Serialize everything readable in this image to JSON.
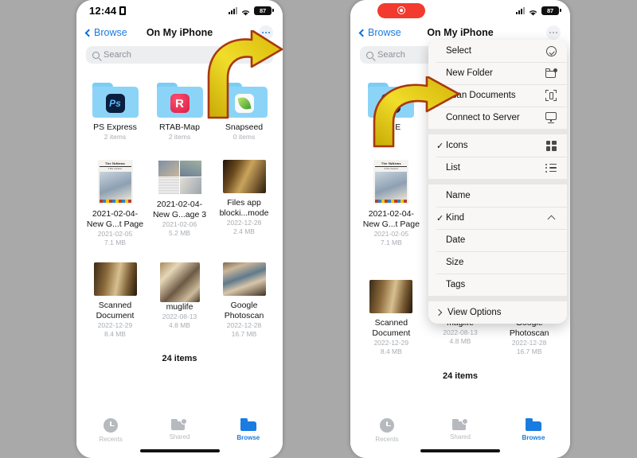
{
  "background_color": "#a9a9a9",
  "accent_color": "#1a7be0",
  "phones": [
    {
      "id": "left",
      "status_bar": {
        "time": "12:44",
        "location_icon": "location-arrow-icon",
        "signal_icon": "cellular-signal-icon",
        "wifi_icon": "wifi-icon",
        "battery_level": "87"
      },
      "nav": {
        "back_label": "Browse",
        "title": "On My iPhone",
        "more_icon": "ellipsis-circle-icon"
      },
      "search": {
        "placeholder": "Search",
        "icon": "search-icon"
      },
      "items": [
        {
          "type": "folder",
          "name": "PS Express",
          "sub1": "2 items",
          "sub2": "",
          "app": "ps",
          "app_label": "Ps"
        },
        {
          "type": "folder",
          "name": "RTAB-Map",
          "sub1": "2 items",
          "sub2": "",
          "app": "rtab",
          "app_label": "R"
        },
        {
          "type": "folder",
          "name": "Snapseed",
          "sub1": "0 items",
          "sub2": "",
          "app": "snap",
          "app_label": ""
        },
        {
          "type": "file",
          "thumb": "news",
          "name": "2021-02-04-\nNew G...t Page",
          "sub1": "2021-02-05",
          "sub2": "7.1 MB"
        },
        {
          "type": "file",
          "thumb": "mag",
          "name": "2021-02-04-\nNew G...age 3",
          "sub1": "2021-02-06",
          "sub2": "5.2 MB"
        },
        {
          "type": "file",
          "thumb": "roomA",
          "name": "Files app\nblocki...mode",
          "sub1": "2022-12-28",
          "sub2": "2.4 MB"
        },
        {
          "type": "file",
          "thumb": "roomB",
          "name": "Scanned\nDocument",
          "sub1": "2022-12-29",
          "sub2": "8.4 MB"
        },
        {
          "type": "file",
          "thumb": "roomC",
          "name": "muglife",
          "sub1": "2022-08-13",
          "sub2": "4.8 MB"
        },
        {
          "type": "file",
          "thumb": "roomD",
          "name": "Google\nPhotoscan",
          "sub1": "2022-12-28",
          "sub2": "16.7 MB"
        }
      ],
      "item_count": "24 items",
      "tabs": [
        {
          "label": "Recents",
          "icon": "clock-icon",
          "active": false
        },
        {
          "label": "Shared",
          "icon": "shared-folder-icon",
          "active": false
        },
        {
          "label": "Browse",
          "icon": "folder-icon",
          "active": true
        }
      ]
    },
    {
      "id": "right",
      "status_bar": {
        "recording_pill": "screen-recording-indicator",
        "signal_icon": "cellular-signal-icon",
        "wifi_icon": "wifi-icon",
        "battery_level": "87"
      },
      "nav": {
        "back_label": "Browse",
        "title": "On My iPhone",
        "more_icon": "ellipsis-circle-icon"
      },
      "search": {
        "placeholder": "Search",
        "icon": "search-icon"
      },
      "items": [
        {
          "type": "folder",
          "name": "PS E",
          "sub1": "2",
          "sub2": "",
          "app": "ps",
          "app_label": "Ps"
        },
        {
          "type": "file",
          "thumb": "news",
          "name": "2021-02-04-\nNew G...t Page",
          "sub1": "2021-02-05",
          "sub2": "7.1 MB"
        },
        {
          "type": "file",
          "thumb": "roomB",
          "name": "Scanned\nDocument",
          "sub1": "2022-12-29",
          "sub2": "8.4 MB"
        },
        {
          "type": "file",
          "thumb": "roomC",
          "name": "muglife",
          "sub1": "2022-08-13",
          "sub2": "4.8 MB"
        },
        {
          "type": "file",
          "thumb": "roomD",
          "name": "Google\nPhotoscan",
          "sub1": "2022-12-28",
          "sub2": "16.7 MB"
        }
      ],
      "item_count": "24 items",
      "tabs": [
        {
          "label": "Recents",
          "icon": "clock-icon",
          "active": false
        },
        {
          "label": "Shared",
          "icon": "shared-folder-icon",
          "active": false
        },
        {
          "label": "Browse",
          "icon": "folder-icon",
          "active": true
        }
      ],
      "context_menu": {
        "groups": [
          {
            "items": [
              {
                "label": "Select",
                "icon": "check-circle-icon",
                "checked": false
              },
              {
                "label": "New Folder",
                "icon": "new-folder-icon",
                "checked": false
              },
              {
                "label": "Scan Documents",
                "icon": "scan-document-icon",
                "checked": false
              },
              {
                "label": "Connect to Server",
                "icon": "server-icon",
                "checked": false
              }
            ]
          },
          {
            "items": [
              {
                "label": "Icons",
                "icon": "grid-view-icon",
                "checked": true
              },
              {
                "label": "List",
                "icon": "list-view-icon",
                "checked": false
              }
            ]
          },
          {
            "items": [
              {
                "label": "Name",
                "icon": "",
                "checked": false
              },
              {
                "label": "Kind",
                "icon": "chevron-up-icon",
                "checked": true
              },
              {
                "label": "Date",
                "icon": "",
                "checked": false
              },
              {
                "label": "Size",
                "icon": "",
                "checked": false
              },
              {
                "label": "Tags",
                "icon": "",
                "checked": false
              }
            ]
          },
          {
            "items": [
              {
                "label": "View Options",
                "icon": "chevron-right-icon",
                "checked": false,
                "leading_chevron": true
              }
            ]
          }
        ]
      }
    }
  ],
  "annotations": [
    {
      "name": "curved-arrow-to-more-button",
      "color_fill": "#e8d21a",
      "color_stroke": "#a33a12"
    },
    {
      "name": "curved-arrow-to-menu",
      "color_fill": "#e8d21a",
      "color_stroke": "#a33a12"
    }
  ]
}
